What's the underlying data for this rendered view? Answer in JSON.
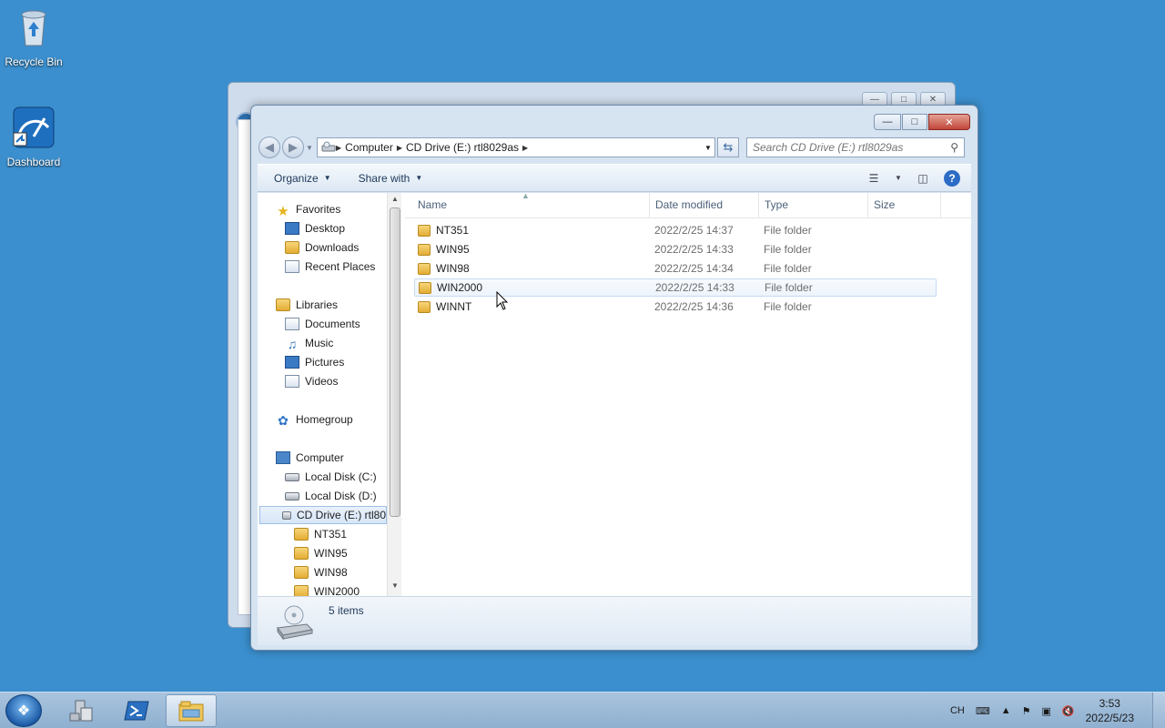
{
  "desktop": {
    "icons": [
      {
        "label": "Recycle Bin",
        "icon": "recycle-bin-icon"
      },
      {
        "label": "Dashboard",
        "icon": "dashboard-icon"
      }
    ]
  },
  "window": {
    "address": {
      "crumbs": [
        "Computer",
        "CD Drive (E:) rtl8029as"
      ]
    },
    "search_placeholder": "Search CD Drive (E:) rtl8029as",
    "toolbar": {
      "organize": "Organize",
      "share_with": "Share with"
    },
    "nav": {
      "favorites": "Favorites",
      "desktop": "Desktop",
      "downloads": "Downloads",
      "recent": "Recent Places",
      "libraries": "Libraries",
      "documents": "Documents",
      "music": "Music",
      "pictures": "Pictures",
      "videos": "Videos",
      "homegroup": "Homegroup",
      "computer": "Computer",
      "disk_c": "Local Disk (C:)",
      "disk_d": "Local Disk (D:)",
      "cd_drive": "CD Drive (E:) rtl80",
      "sub": [
        "NT351",
        "WIN95",
        "WIN98",
        "WIN2000"
      ]
    },
    "columns": {
      "name": "Name",
      "date": "Date modified",
      "type": "Type",
      "size": "Size"
    },
    "files": [
      {
        "name": "NT351",
        "date": "2022/2/25 14:37",
        "type": "File folder"
      },
      {
        "name": "WIN95",
        "date": "2022/2/25 14:33",
        "type": "File folder"
      },
      {
        "name": "WIN98",
        "date": "2022/2/25 14:34",
        "type": "File folder"
      },
      {
        "name": "WIN2000",
        "date": "2022/2/25 14:33",
        "type": "File folder"
      },
      {
        "name": "WINNT",
        "date": "2022/2/25 14:36",
        "type": "File folder"
      }
    ],
    "status": "5 items"
  },
  "taskbar": {
    "lang": "CH",
    "time": "3:53",
    "date": "2022/5/23"
  }
}
